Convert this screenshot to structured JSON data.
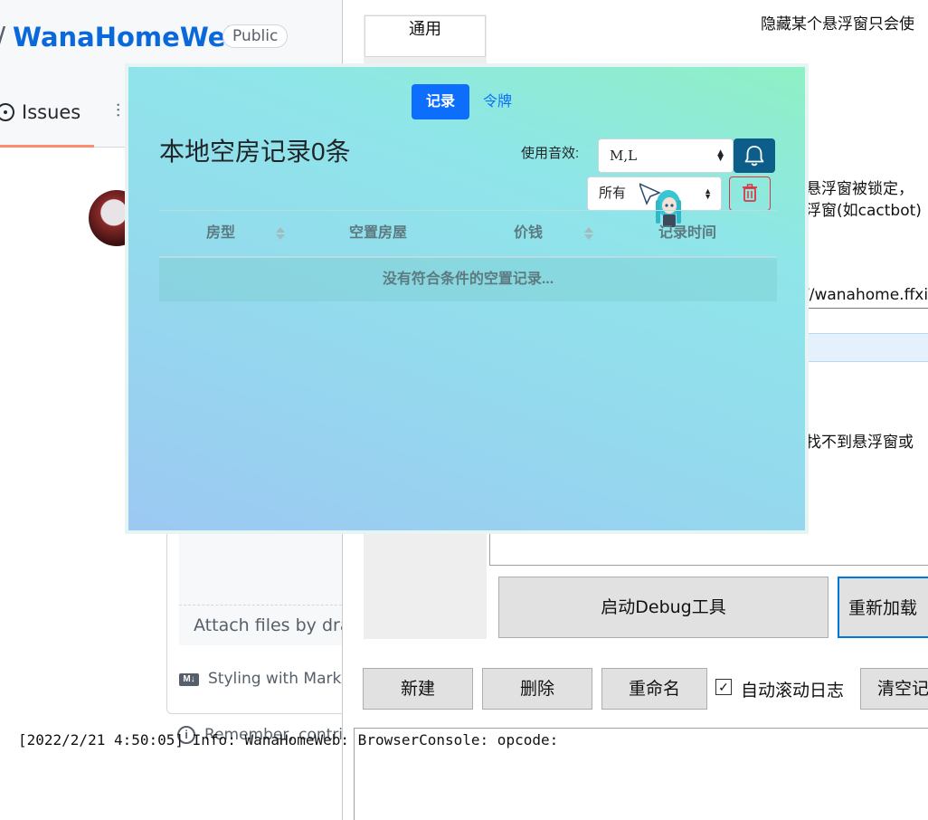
{
  "github": {
    "slash": "/",
    "repo_name": "WanaHomeWeb",
    "visibility": "Public",
    "tab_issues": "Issues",
    "attach_text": "Attach files by drag",
    "styling_text": "Styling with Markd",
    "md_icon_text": "M↓",
    "remember_text": "Remember, contrib"
  },
  "window": {
    "tab_general": "通用",
    "hint_top": "隐藏某个悬浮窗只会使",
    "hint_lock": "悬浮窗被锁定，",
    "hint_cactbot": "浮窗(如cactbot)",
    "url_value": "//wanahome.ffxiv",
    "hint_notfound": "找不到悬浮窗或",
    "btn_debug": "启动Debug工具",
    "btn_reload": "重新加载（",
    "btn_new": "新建",
    "btn_delete": "删除",
    "btn_rename": "重命名",
    "autoscroll_checked": "✓",
    "autoscroll_label": "自动滚动日志",
    "btn_clear": "清空记",
    "log_line": "[2022/2/21 4:50:05] Info: WanaHomeWeb: BrowserConsole: opcode:"
  },
  "overlay": {
    "tab_record": "记录",
    "tab_token": "令牌",
    "title": "本地空房记录0条",
    "sound_label": "使用音效:",
    "sound_value": "M,L",
    "filter_value": "所有",
    "columns": [
      "房型",
      "空置房屋",
      "价钱",
      "记录时间"
    ],
    "empty_text": "没有符合条件的空置记录..."
  },
  "colors": {
    "primary": "#0d6efd",
    "bell_bg": "#0d5d8a",
    "danger": "#dc3545",
    "github_link": "#0969da"
  }
}
